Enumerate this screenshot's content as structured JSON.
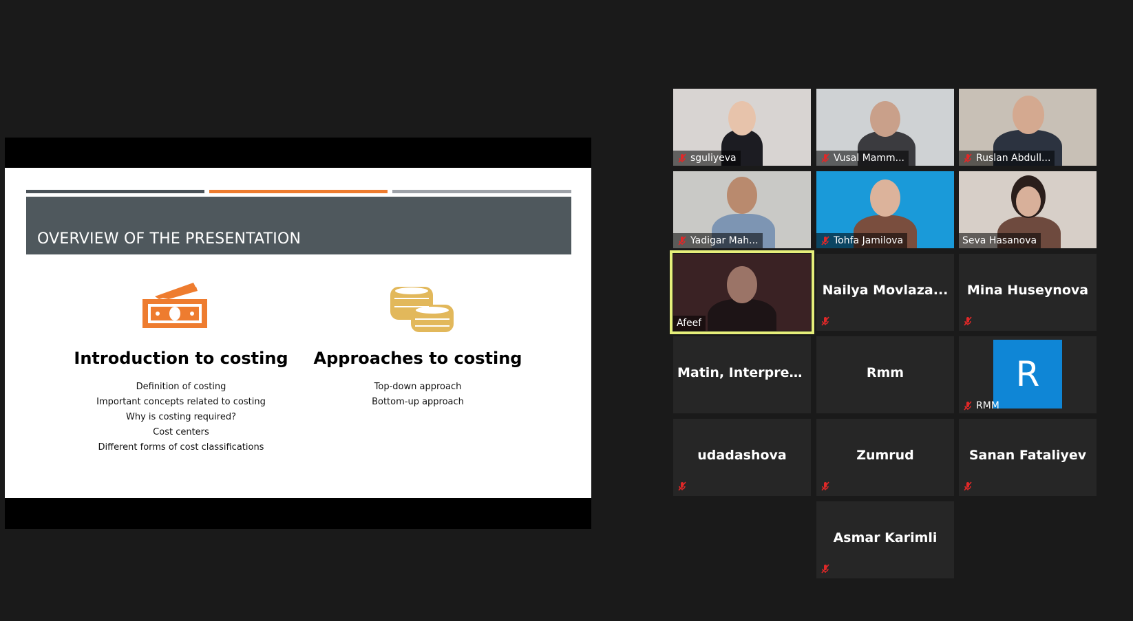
{
  "slide": {
    "title": "OVERVIEW OF THE PRESENTATION",
    "left": {
      "icon": "money-bill-icon",
      "heading": "Introduction to costing",
      "items": [
        "Definition of costing",
        "Important concepts related to costing",
        "Why is costing required?",
        "Cost centers",
        "Different forms of cost classifications"
      ]
    },
    "right": {
      "icon": "coins-icon",
      "heading": "Approaches to costing",
      "items": [
        "Top-down approach",
        "Bottom-up approach"
      ]
    },
    "colors": {
      "accent_orange": "#ee7c2f",
      "title_bg": "#4f585d",
      "coins_gold": "#e2b85b"
    }
  },
  "participants": [
    {
      "name": "sguliyeva",
      "muted": true,
      "video": true
    },
    {
      "name": "Vusal Mamm...",
      "muted": true,
      "video": true
    },
    {
      "name": "Ruslan Abdull...",
      "muted": true,
      "video": true
    },
    {
      "name": "Yadigar Mah...",
      "muted": true,
      "video": true
    },
    {
      "name": "Tohfa Jamilova",
      "muted": true,
      "video": true
    },
    {
      "name": "Seva Hasanova",
      "muted": false,
      "video": true
    },
    {
      "name": "Afeef",
      "muted": false,
      "video": true,
      "active_speaker": true
    },
    {
      "name": "Nailya  Movlaza...",
      "muted": true,
      "video": false
    },
    {
      "name": "Mina Huseynova",
      "muted": true,
      "video": false
    },
    {
      "name": "Matin, Interpreter",
      "muted": false,
      "video": false
    },
    {
      "name": "Rmm",
      "muted": false,
      "video": false
    },
    {
      "name": "RMM",
      "muted": true,
      "video": false,
      "avatar_letter": "R"
    },
    {
      "name": "udadashova",
      "muted": true,
      "video": false
    },
    {
      "name": "Zumrud",
      "muted": true,
      "video": false
    },
    {
      "name": "Sanan Fataliyev",
      "muted": true,
      "video": false
    },
    {
      "name": "Asmar Karimli",
      "muted": true,
      "video": false
    }
  ],
  "colors": {
    "active_speaker_border": "#e6ef7a",
    "mute_red": "#e02828",
    "avatar_blue": "#0f86d6"
  }
}
